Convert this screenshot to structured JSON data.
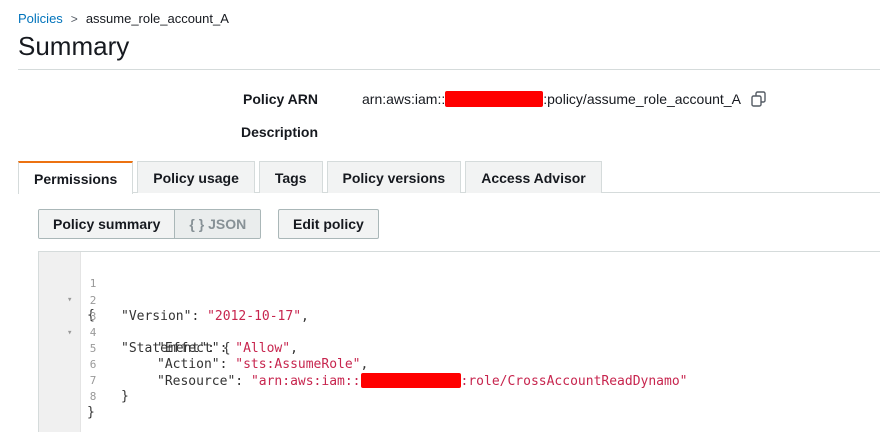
{
  "breadcrumb": {
    "parent": "Policies",
    "separator": ">",
    "current": "assume_role_account_A"
  },
  "page": {
    "title": "Summary"
  },
  "summary": {
    "arn_label": "Policy ARN",
    "arn_prefix": "arn:aws:iam::",
    "arn_suffix": ":policy/assume_role_account_A",
    "description_label": "Description",
    "copy_icon": "copy-icon"
  },
  "tabs": [
    {
      "label": "Permissions",
      "active": true
    },
    {
      "label": "Policy usage",
      "active": false
    },
    {
      "label": "Tags",
      "active": false
    },
    {
      "label": "Policy versions",
      "active": false
    },
    {
      "label": "Access Advisor",
      "active": false
    }
  ],
  "toolbar": {
    "policy_summary_label": "Policy summary",
    "json_label": "{ } JSON",
    "edit_policy_label": "Edit policy"
  },
  "editor": {
    "line_numbers": [
      "1",
      "2",
      "3",
      "4",
      "5",
      "6",
      "7",
      "8"
    ],
    "l1": "{",
    "l2_key": "\"Version\"",
    "l2_colon": ": ",
    "l2_val": "\"2012-10-17\"",
    "l2_end": ",",
    "l3_key": "\"Statement\"",
    "l3_rest": ": {",
    "l4_key": "\"Effect\"",
    "l4_colon": ": ",
    "l4_val": "\"Allow\"",
    "l4_end": ",",
    "l5_key": "\"Action\"",
    "l5_colon": ": ",
    "l5_val": "\"sts:AssumeRole\"",
    "l5_end": ",",
    "l6_key": "\"Resource\"",
    "l6_colon": ": ",
    "l6_val_prefix": "\"arn:aws:iam::",
    "l6_val_suffix": ":role/CrossAccountReadDynamo\"",
    "l7": "}",
    "l8": "}"
  },
  "colors": {
    "accent": "#ec7211",
    "link": "#0073bb",
    "string": "#c7254e",
    "redaction": "#ff0000"
  }
}
